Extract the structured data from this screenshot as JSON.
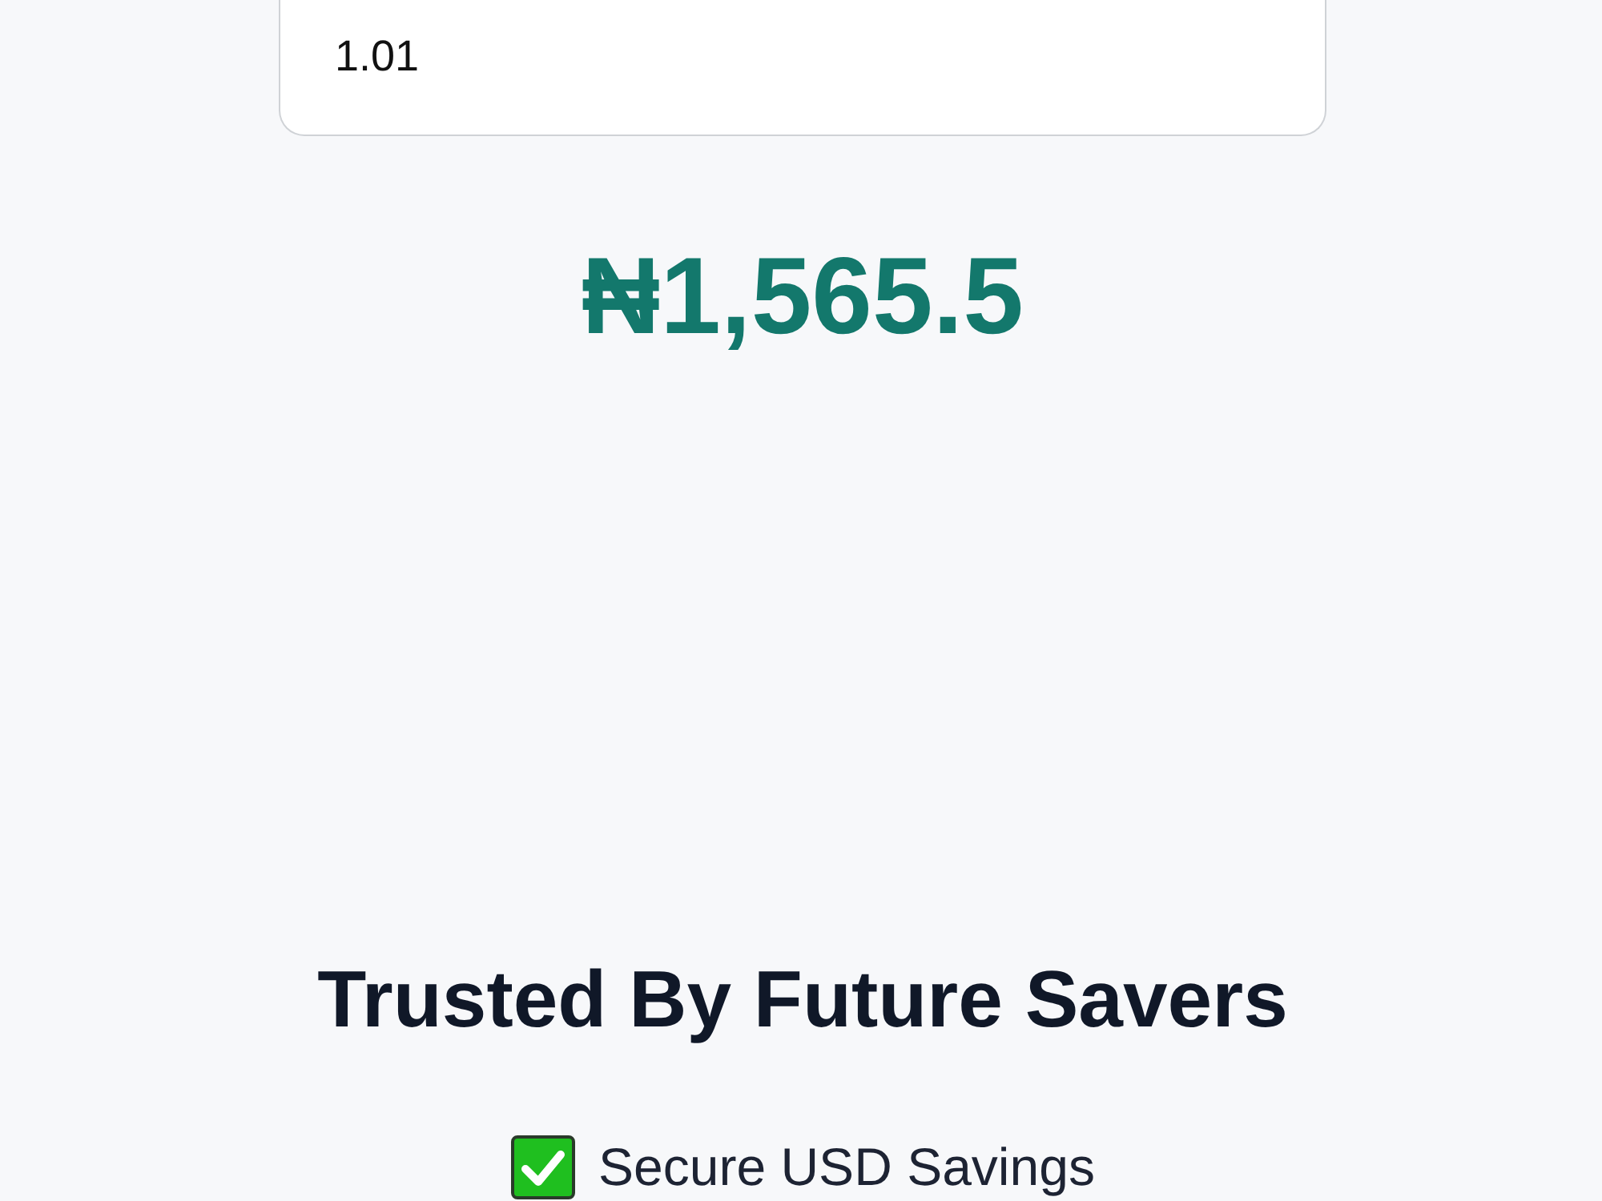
{
  "amount_field": {
    "value": "1.01"
  },
  "converted_amount": "₦1,565.5",
  "trust_section": {
    "heading": "Trusted By Future Savers",
    "features": [
      {
        "label": "Secure USD Savings"
      }
    ]
  }
}
